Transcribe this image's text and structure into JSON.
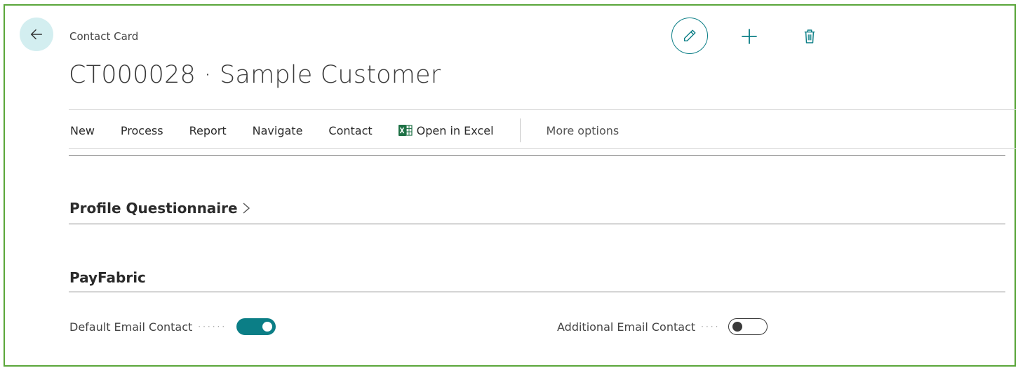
{
  "header": {
    "breadcrumb": "Contact Card",
    "title": "CT000028 · Sample Customer",
    "back_icon": "arrow-left-icon",
    "edit_icon": "pencil-icon",
    "add_icon": "plus-icon",
    "delete_icon": "trash-icon"
  },
  "actionbar": {
    "items": [
      "New",
      "Process",
      "Report",
      "Navigate",
      "Contact"
    ],
    "excel_label": "Open in Excel",
    "more_label": "More options"
  },
  "sections": {
    "profile_title": "Profile Questionnaire",
    "payfabric_title": "PayFabric"
  },
  "fields": {
    "default_email_label": "Default Email Contact",
    "default_email_value": true,
    "additional_email_label": "Additional Email Contact",
    "additional_email_value": false
  },
  "colors": {
    "accent": "#0b7e86",
    "back_bg": "#d3eef0",
    "frame_border": "#5aa63a",
    "excel_green": "#1e7145"
  }
}
